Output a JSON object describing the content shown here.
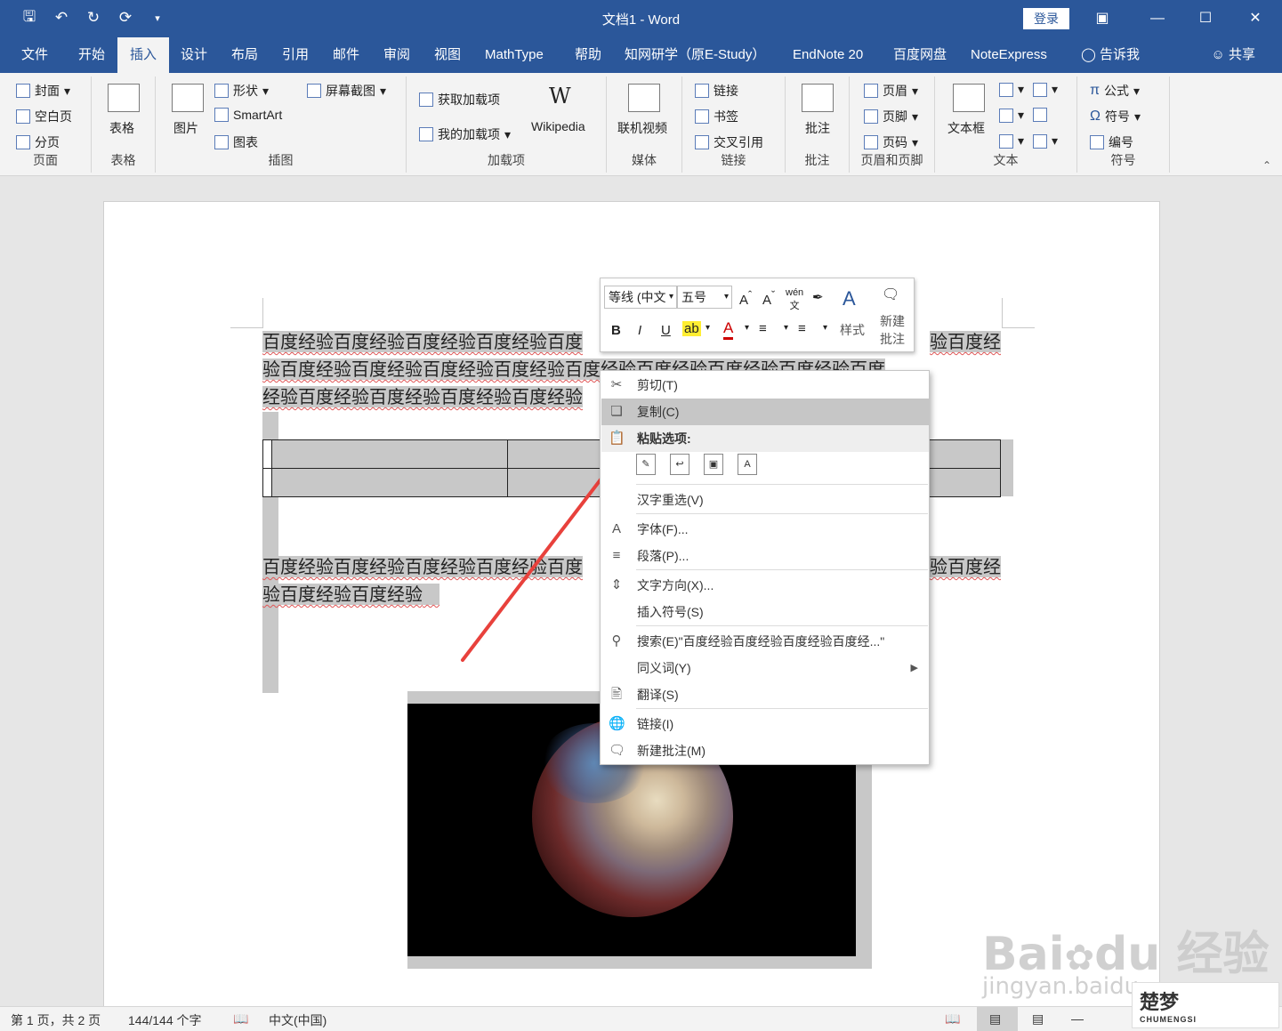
{
  "titlebar": {
    "title": "文档1  -  Word",
    "login": "登录",
    "qat": [
      "save-icon",
      "undo-icon",
      "redo-icon",
      "repeat-icon",
      "customize-icon"
    ]
  },
  "tabs": [
    "文件",
    "开始",
    "插入",
    "设计",
    "布局",
    "引用",
    "邮件",
    "审阅",
    "视图",
    "MathType",
    "帮助",
    "知网研学（原E-Study）",
    "EndNote 20",
    "百度网盘",
    "NoteExpress",
    "告诉我",
    "共享"
  ],
  "active_tab": "插入",
  "ribbon": {
    "pages": {
      "label": "页面",
      "items": [
        "封面",
        "空白页",
        "分页"
      ]
    },
    "table": {
      "label": "表格",
      "item": "表格"
    },
    "illustrations": {
      "label": "插图",
      "picture": "图片",
      "shapes": "形状",
      "smartart": "SmartArt",
      "chart": "图表",
      "screenshot": "屏幕截图"
    },
    "addins": {
      "label": "加载项",
      "get": "获取加载项",
      "mine": "我的加载项",
      "wikipedia": "Wikipedia"
    },
    "media": {
      "label": "媒体",
      "video": "联机视频"
    },
    "links": {
      "label": "链接",
      "items": [
        "链接",
        "书签",
        "交叉引用"
      ]
    },
    "comments": {
      "label": "批注",
      "item": "批注"
    },
    "headerfooter": {
      "label": "页眉和页脚",
      "items": [
        "页眉",
        "页脚",
        "页码"
      ]
    },
    "text": {
      "label": "文本",
      "textbox": "文本框"
    },
    "symbols": {
      "label": "符号",
      "items": [
        "公式",
        "符号",
        "编号"
      ]
    }
  },
  "document": {
    "para1_lines": [
      "百度经验百度经验百度经验百度经验百度",
      "验百度经验百度经验百度经验百度经验百度经验百度经验百度经验百度经验百度",
      "经验百度经验百度经验百度经验百度经验"
    ],
    "para1_right": "验百度经",
    "para2_lines": [
      "百度经验百度经验百度经验百度经验百度",
      "验百度经验百度经验"
    ],
    "para2_right": "验百度经"
  },
  "minitoolbar": {
    "font": "等线 (中文",
    "size": "五号",
    "styles_label": "样式",
    "new_comment_label": "新建\n批注",
    "buttons": [
      "B",
      "I",
      "U"
    ]
  },
  "contextmenu": {
    "items": [
      {
        "label": "剪切(T)",
        "icon": "cut-icon"
      },
      {
        "label": "复制(C)",
        "icon": "copy-icon"
      },
      {
        "label": "粘贴选项:",
        "icon": "paste-icon"
      },
      {
        "label": "汉字重选(V)",
        "icon": ""
      },
      {
        "label": "字体(F)...",
        "icon": "font-icon"
      },
      {
        "label": "段落(P)...",
        "icon": "paragraph-icon"
      },
      {
        "label": "文字方向(X)...",
        "icon": "text-direction-icon"
      },
      {
        "label": "插入符号(S)",
        "icon": ""
      },
      {
        "label": "搜索(E)\"百度经验百度经验百度经验百度经...\"",
        "icon": "search-icon"
      },
      {
        "label": "同义词(Y)",
        "icon": ""
      },
      {
        "label": "翻译(S)",
        "icon": "translate-icon"
      },
      {
        "label": "链接(I)",
        "icon": "link-icon"
      },
      {
        "label": "新建批注(M)",
        "icon": "comment-icon"
      }
    ],
    "highlighted": "复制(C)"
  },
  "statusbar": {
    "page": "第 1 页，共 2 页",
    "words": "144/144 个字",
    "language": "中文(中国)"
  },
  "watermark": {
    "baidu": "Bai",
    "du": "du",
    "jingyan": "经验",
    "url": "jingyan.baidu",
    "chumeng": "楚梦",
    "chumeng_en": "CHUMENGSI"
  },
  "colors": {
    "titlebar": "#2b579a",
    "selection": "#c8c8c8",
    "arrow": "#e8413c",
    "menu_highlight": "#c6c6c6"
  }
}
